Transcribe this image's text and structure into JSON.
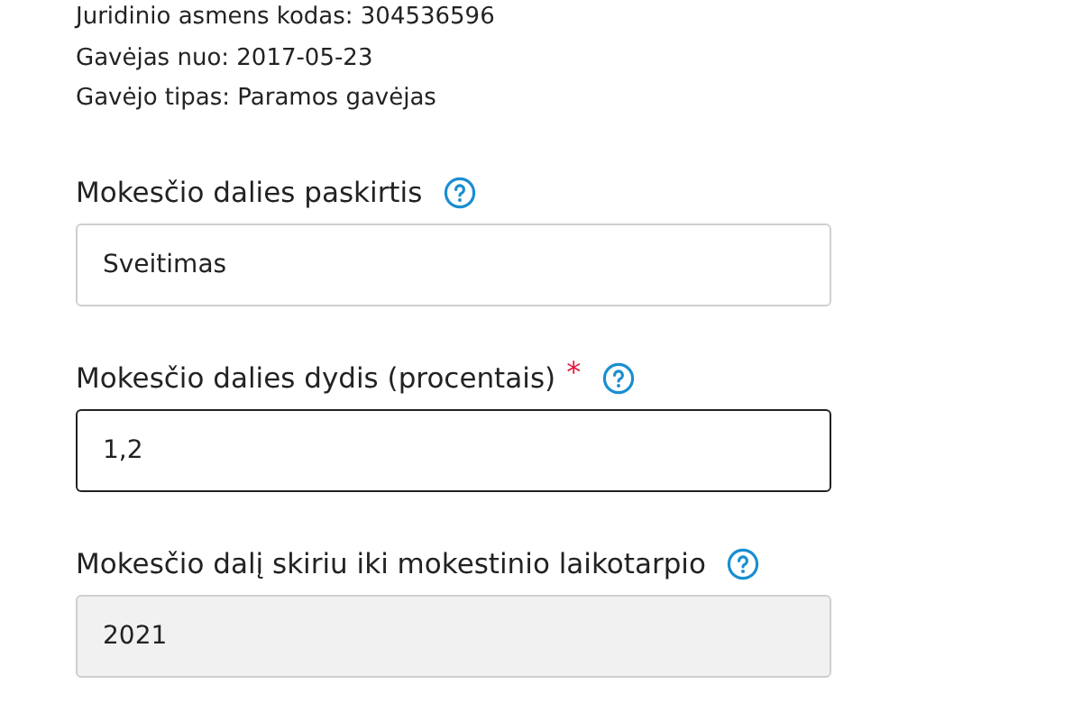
{
  "info_lines": [
    "Juridinio asmens kodas: 304536596",
    "Gavėjas nuo: 2017-05-23",
    "Gavėjo tipas: Paramos gavėjas"
  ],
  "fields": [
    {
      "label": "Mokesčio dalies paskirtis",
      "required": false,
      "value": "Sveitimas",
      "focused": false,
      "disabled": false
    },
    {
      "label": "Mokesčio dalies dydis (procentais)",
      "required": true,
      "required_mark": "*",
      "value": "1,2",
      "focused": true,
      "disabled": false
    },
    {
      "label": "Mokesčio dalį skiriu iki mokestinio laikotarpio",
      "required": false,
      "value": "2021",
      "focused": false,
      "disabled": true
    }
  ]
}
